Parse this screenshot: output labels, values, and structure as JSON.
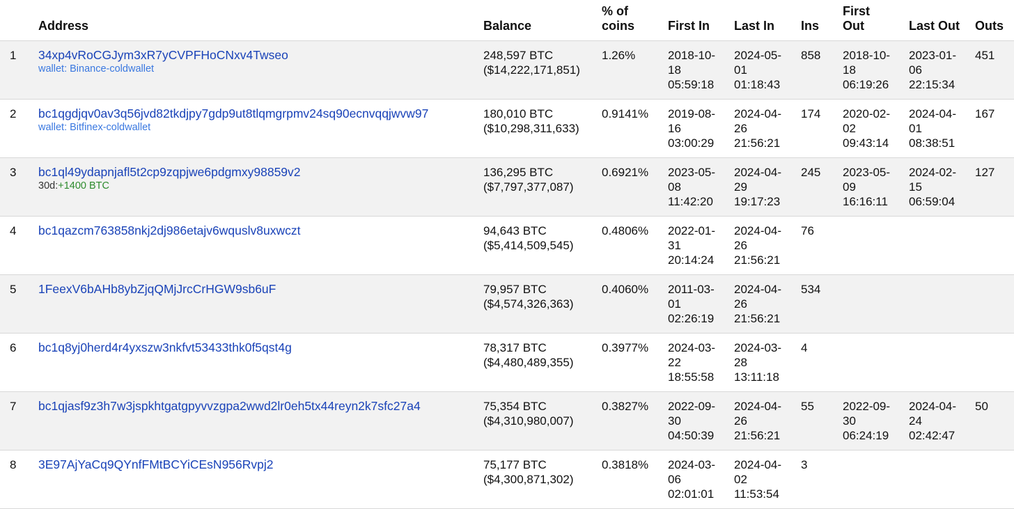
{
  "headers": {
    "rank": "",
    "address": "Address",
    "balance": "Balance",
    "pct_line1": "% of",
    "pct_line2": "coins",
    "first_in": "First In",
    "last_in": "Last In",
    "ins": "Ins",
    "first_out_line1": "First",
    "first_out_line2": "Out",
    "last_out": "Last Out",
    "outs": "Outs"
  },
  "rows": [
    {
      "rank": "1",
      "address": "34xp4vRoCGJym3xR7yCVPFHoCNxv4Twseo",
      "wallet_label": "wallet: ",
      "wallet_name": "Binance-coldwallet",
      "change_label": "",
      "change_value": "",
      "balance_btc": "248,597 BTC",
      "balance_usd": "($14,222,171,851)",
      "pct": "1.26%",
      "first_in": [
        "2018-10-",
        "18",
        "05:59:18"
      ],
      "last_in": [
        "2024-05-",
        "01",
        "01:18:43"
      ],
      "ins": "858",
      "first_out": [
        "2018-10-",
        "18",
        "06:19:26"
      ],
      "last_out": [
        "2023-01-",
        "06",
        "22:15:34"
      ],
      "outs": "451"
    },
    {
      "rank": "2",
      "address": "bc1qgdjqv0av3q56jvd82tkdjpy7gdp9ut8tlqmgrpmv24sq90ecnvqqjwvw97",
      "wallet_label": "wallet: ",
      "wallet_name": "Bitfinex-coldwallet",
      "change_label": "",
      "change_value": "",
      "balance_btc": "180,010 BTC",
      "balance_usd": "($10,298,311,633)",
      "pct": "0.9141%",
      "first_in": [
        "2019-08-",
        "16",
        "03:00:29"
      ],
      "last_in": [
        "2024-04-",
        "26",
        "21:56:21"
      ],
      "ins": "174",
      "first_out": [
        "2020-02-",
        "02",
        "09:43:14"
      ],
      "last_out": [
        "2024-04-",
        "01",
        "08:38:51"
      ],
      "outs": "167"
    },
    {
      "rank": "3",
      "address": "bc1ql49ydapnjafl5t2cp9zqpjwe6pdgmxy98859v2",
      "wallet_label": "",
      "wallet_name": "",
      "change_label": "30d:",
      "change_value": "+1400 BTC",
      "balance_btc": "136,295 BTC",
      "balance_usd": "($7,797,377,087)",
      "pct": "0.6921%",
      "first_in": [
        "2023-05-",
        "08",
        "11:42:20"
      ],
      "last_in": [
        "2024-04-",
        "29",
        "19:17:23"
      ],
      "ins": "245",
      "first_out": [
        "2023-05-",
        "09",
        "16:16:11"
      ],
      "last_out": [
        "2024-02-",
        "15",
        "06:59:04"
      ],
      "outs": "127"
    },
    {
      "rank": "4",
      "address": "bc1qazcm763858nkj2dj986etajv6wquslv8uxwczt",
      "wallet_label": "",
      "wallet_name": "",
      "change_label": "",
      "change_value": "",
      "balance_btc": "94,643 BTC",
      "balance_usd": "($5,414,509,545)",
      "pct": "0.4806%",
      "first_in": [
        "2022-01-",
        "31",
        "20:14:24"
      ],
      "last_in": [
        "2024-04-",
        "26",
        "21:56:21"
      ],
      "ins": "76",
      "first_out": [
        "",
        "",
        ""
      ],
      "last_out": [
        "",
        "",
        ""
      ],
      "outs": ""
    },
    {
      "rank": "5",
      "address": "1FeexV6bAHb8ybZjqQMjJrcCrHGW9sb6uF",
      "wallet_label": "",
      "wallet_name": "",
      "change_label": "",
      "change_value": "",
      "balance_btc": "79,957 BTC",
      "balance_usd": "($4,574,326,363)",
      "pct": "0.4060%",
      "first_in": [
        "2011-03-",
        "01",
        "02:26:19"
      ],
      "last_in": [
        "2024-04-",
        "26",
        "21:56:21"
      ],
      "ins": "534",
      "first_out": [
        "",
        "",
        ""
      ],
      "last_out": [
        "",
        "",
        ""
      ],
      "outs": ""
    },
    {
      "rank": "6",
      "address": "bc1q8yj0herd4r4yxszw3nkfvt53433thk0f5qst4g",
      "wallet_label": "",
      "wallet_name": "",
      "change_label": "",
      "change_value": "",
      "balance_btc": "78,317 BTC",
      "balance_usd": "($4,480,489,355)",
      "pct": "0.3977%",
      "first_in": [
        "2024-03-",
        "22",
        "18:55:58"
      ],
      "last_in": [
        "2024-03-",
        "28",
        "13:11:18"
      ],
      "ins": "4",
      "first_out": [
        "",
        "",
        ""
      ],
      "last_out": [
        "",
        "",
        ""
      ],
      "outs": ""
    },
    {
      "rank": "7",
      "address": "bc1qjasf9z3h7w3jspkhtgatgpyvvzgpa2wwd2lr0eh5tx44reyn2k7sfc27a4",
      "wallet_label": "",
      "wallet_name": "",
      "change_label": "",
      "change_value": "",
      "balance_btc": "75,354 BTC",
      "balance_usd": "($4,310,980,007)",
      "pct": "0.3827%",
      "first_in": [
        "2022-09-",
        "30",
        "04:50:39"
      ],
      "last_in": [
        "2024-04-",
        "26",
        "21:56:21"
      ],
      "ins": "55",
      "first_out": [
        "2022-09-",
        "30",
        "06:24:19"
      ],
      "last_out": [
        "2024-04-",
        "24",
        "02:42:47"
      ],
      "outs": "50"
    },
    {
      "rank": "8",
      "address": "3E97AjYaCq9QYnfFMtBCYiCEsN956Rvpj2",
      "wallet_label": "",
      "wallet_name": "",
      "change_label": "",
      "change_value": "",
      "balance_btc": "75,177 BTC",
      "balance_usd": "($4,300,871,302)",
      "pct": "0.3818%",
      "first_in": [
        "2024-03-",
        "06",
        "02:01:01"
      ],
      "last_in": [
        "2024-04-",
        "02",
        "11:53:54"
      ],
      "ins": "3",
      "first_out": [
        "",
        "",
        ""
      ],
      "last_out": [
        "",
        "",
        ""
      ],
      "outs": ""
    }
  ]
}
